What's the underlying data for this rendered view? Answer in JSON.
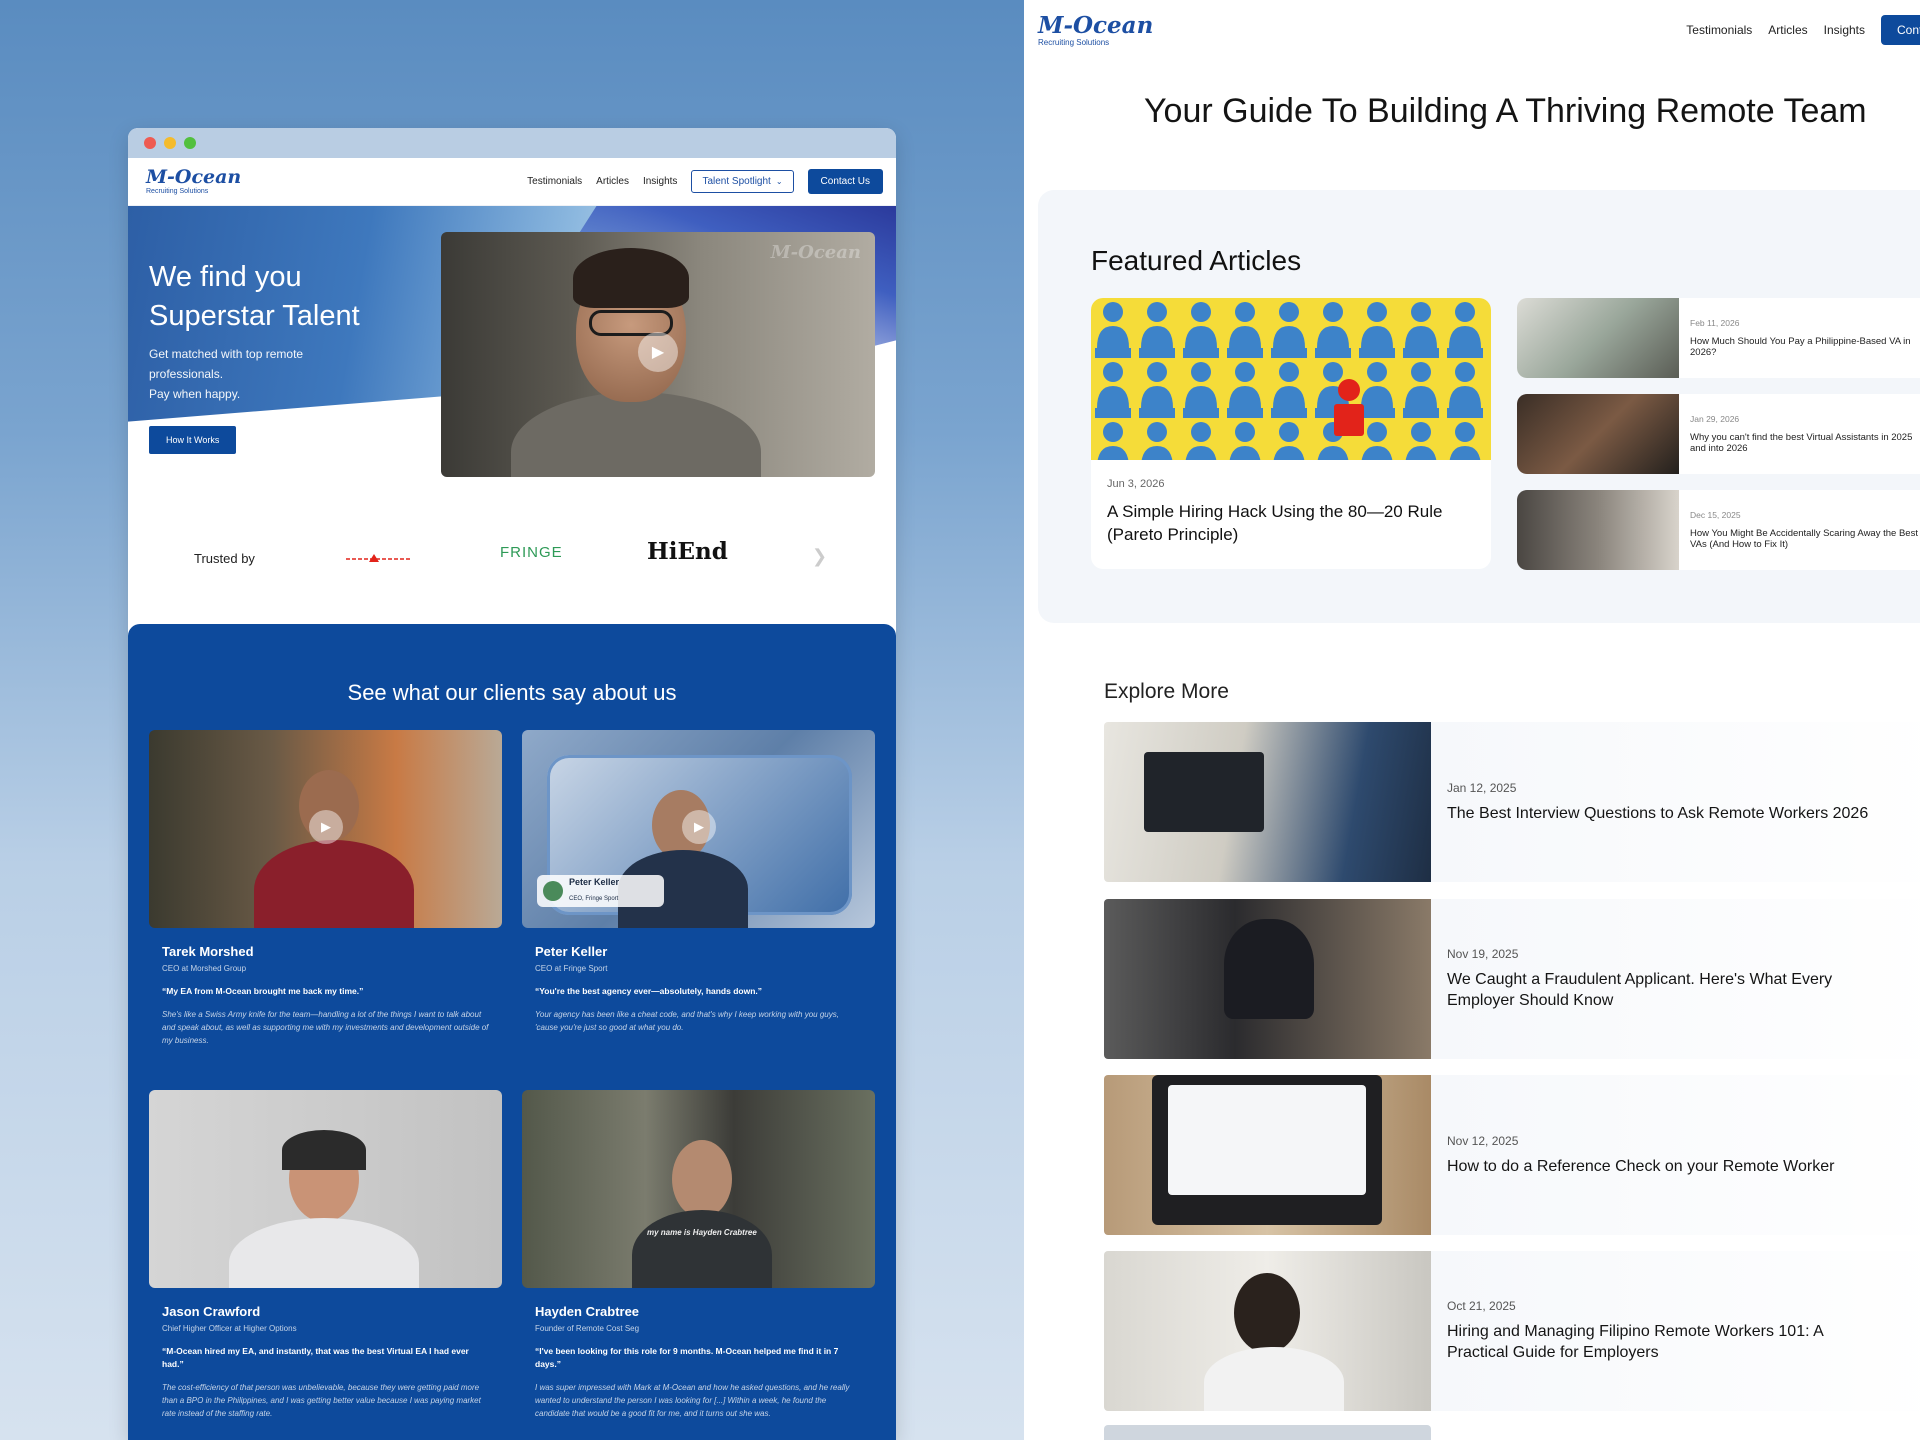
{
  "left": {
    "brand": {
      "name": "M-Ocean",
      "tagline": "Recruiting Solutions"
    },
    "nav": {
      "links": [
        "Testimonials",
        "Articles",
        "Insights"
      ],
      "talent_button": "Talent Spotlight",
      "contact_button": "Contact Us"
    },
    "hero": {
      "headline_1": "We find you",
      "headline_2": "Superstar Talent",
      "sub_1": "Get matched with top remote",
      "sub_2": "professionals.",
      "sub_3": "Pay when happy.",
      "cta": "How It Works"
    },
    "trusted": {
      "label": "Trusted by",
      "logos": [
        "FRINGE",
        "HiEnd"
      ]
    },
    "testimonials": {
      "heading": "See what our clients say about us",
      "items": [
        {
          "name": "Tarek Morshed",
          "role": "CEO at Morshed Group",
          "quote": "“My EA from M-Ocean brought me back my time.”",
          "detail": "She's like a Swiss Army knife for the team—handling a lot of the things I want to talk about and speak about, as well as supporting me with my investments and development outside of my business."
        },
        {
          "name": "Peter Keller",
          "role": "CEO at Fringe Sport",
          "quote": "“You're the best agency ever—absolutely, hands down.”",
          "detail": "Your agency has been like a cheat code, and that's why I keep working with you guys, 'cause you're just so good at what you do.",
          "video_name": "Peter Keller",
          "video_role": "CEO, Fringe Sport"
        },
        {
          "name": "Jason Crawford",
          "role": "Chief Higher Officer at Higher Options",
          "quote": "“M-Ocean hired my EA, and instantly, that was the best Virtual EA I had ever had.”",
          "detail": "The cost-efficiency of that person was unbelievable, because they were getting paid more than a BPO in the Philippines, and I was getting better value because I was paying market rate instead of the staffing rate."
        },
        {
          "name": "Hayden Crabtree",
          "role": "Founder of Remote Cost Seg",
          "quote": "“I've been looking for this role for 9 months. M-Ocean helped me find it in 7 days.”",
          "detail": "I was super impressed with Mark at M-Ocean and how he asked questions, and he really wanted to understand the person I was looking for [...] Within a week, he found the candidate that would be a good fit for me, and it turns out she was.",
          "caption": "my name is Hayden Crabtree"
        }
      ]
    }
  },
  "right": {
    "brand": {
      "name": "M-Ocean",
      "tagline": "Recruiting Solutions"
    },
    "nav": {
      "links": [
        "Testimonials",
        "Articles",
        "Insights"
      ],
      "cta": "Contact Us"
    },
    "page_title": "Your Guide To Building A Thriving Remote Team",
    "featured": {
      "heading": "Featured Articles",
      "main": {
        "date": "Jun 3, 2026",
        "title": "A Simple Hiring Hack Using the 80—20 Rule (Pareto Principle)"
      },
      "side": [
        {
          "date": "Feb 11, 2026",
          "title": "How Much Should You Pay a Philippine-Based VA in 2026?"
        },
        {
          "date": "Jan 29, 2026",
          "title": "Why you can't find the best Virtual Assistants in 2025 and into 2026"
        },
        {
          "date": "Dec 15, 2025",
          "title": "How You Might Be Accidentally Scaring Away the Best VAs (And How to Fix It)"
        }
      ]
    },
    "explore": {
      "heading": "Explore More",
      "items": [
        {
          "date": "Jan 12, 2025",
          "title": "The Best Interview Questions to Ask Remote Workers 2026"
        },
        {
          "date": "Nov 19, 2025",
          "title": "We Caught a Fraudulent Applicant. Here's What Every Employer Should Know"
        },
        {
          "date": "Nov 12, 2025",
          "title": "How to do a Reference Check on your Remote Worker"
        },
        {
          "date": "Oct 21, 2025",
          "title": "Hiring and Managing Filipino Remote Workers 101: A Practical Guide for Employers"
        }
      ]
    }
  },
  "colors": {
    "brand_blue": "#0d4a9c",
    "logo_blue": "#1d4fa3",
    "featured_yellow": "#f5dc39",
    "accent_red": "#e2231a"
  }
}
